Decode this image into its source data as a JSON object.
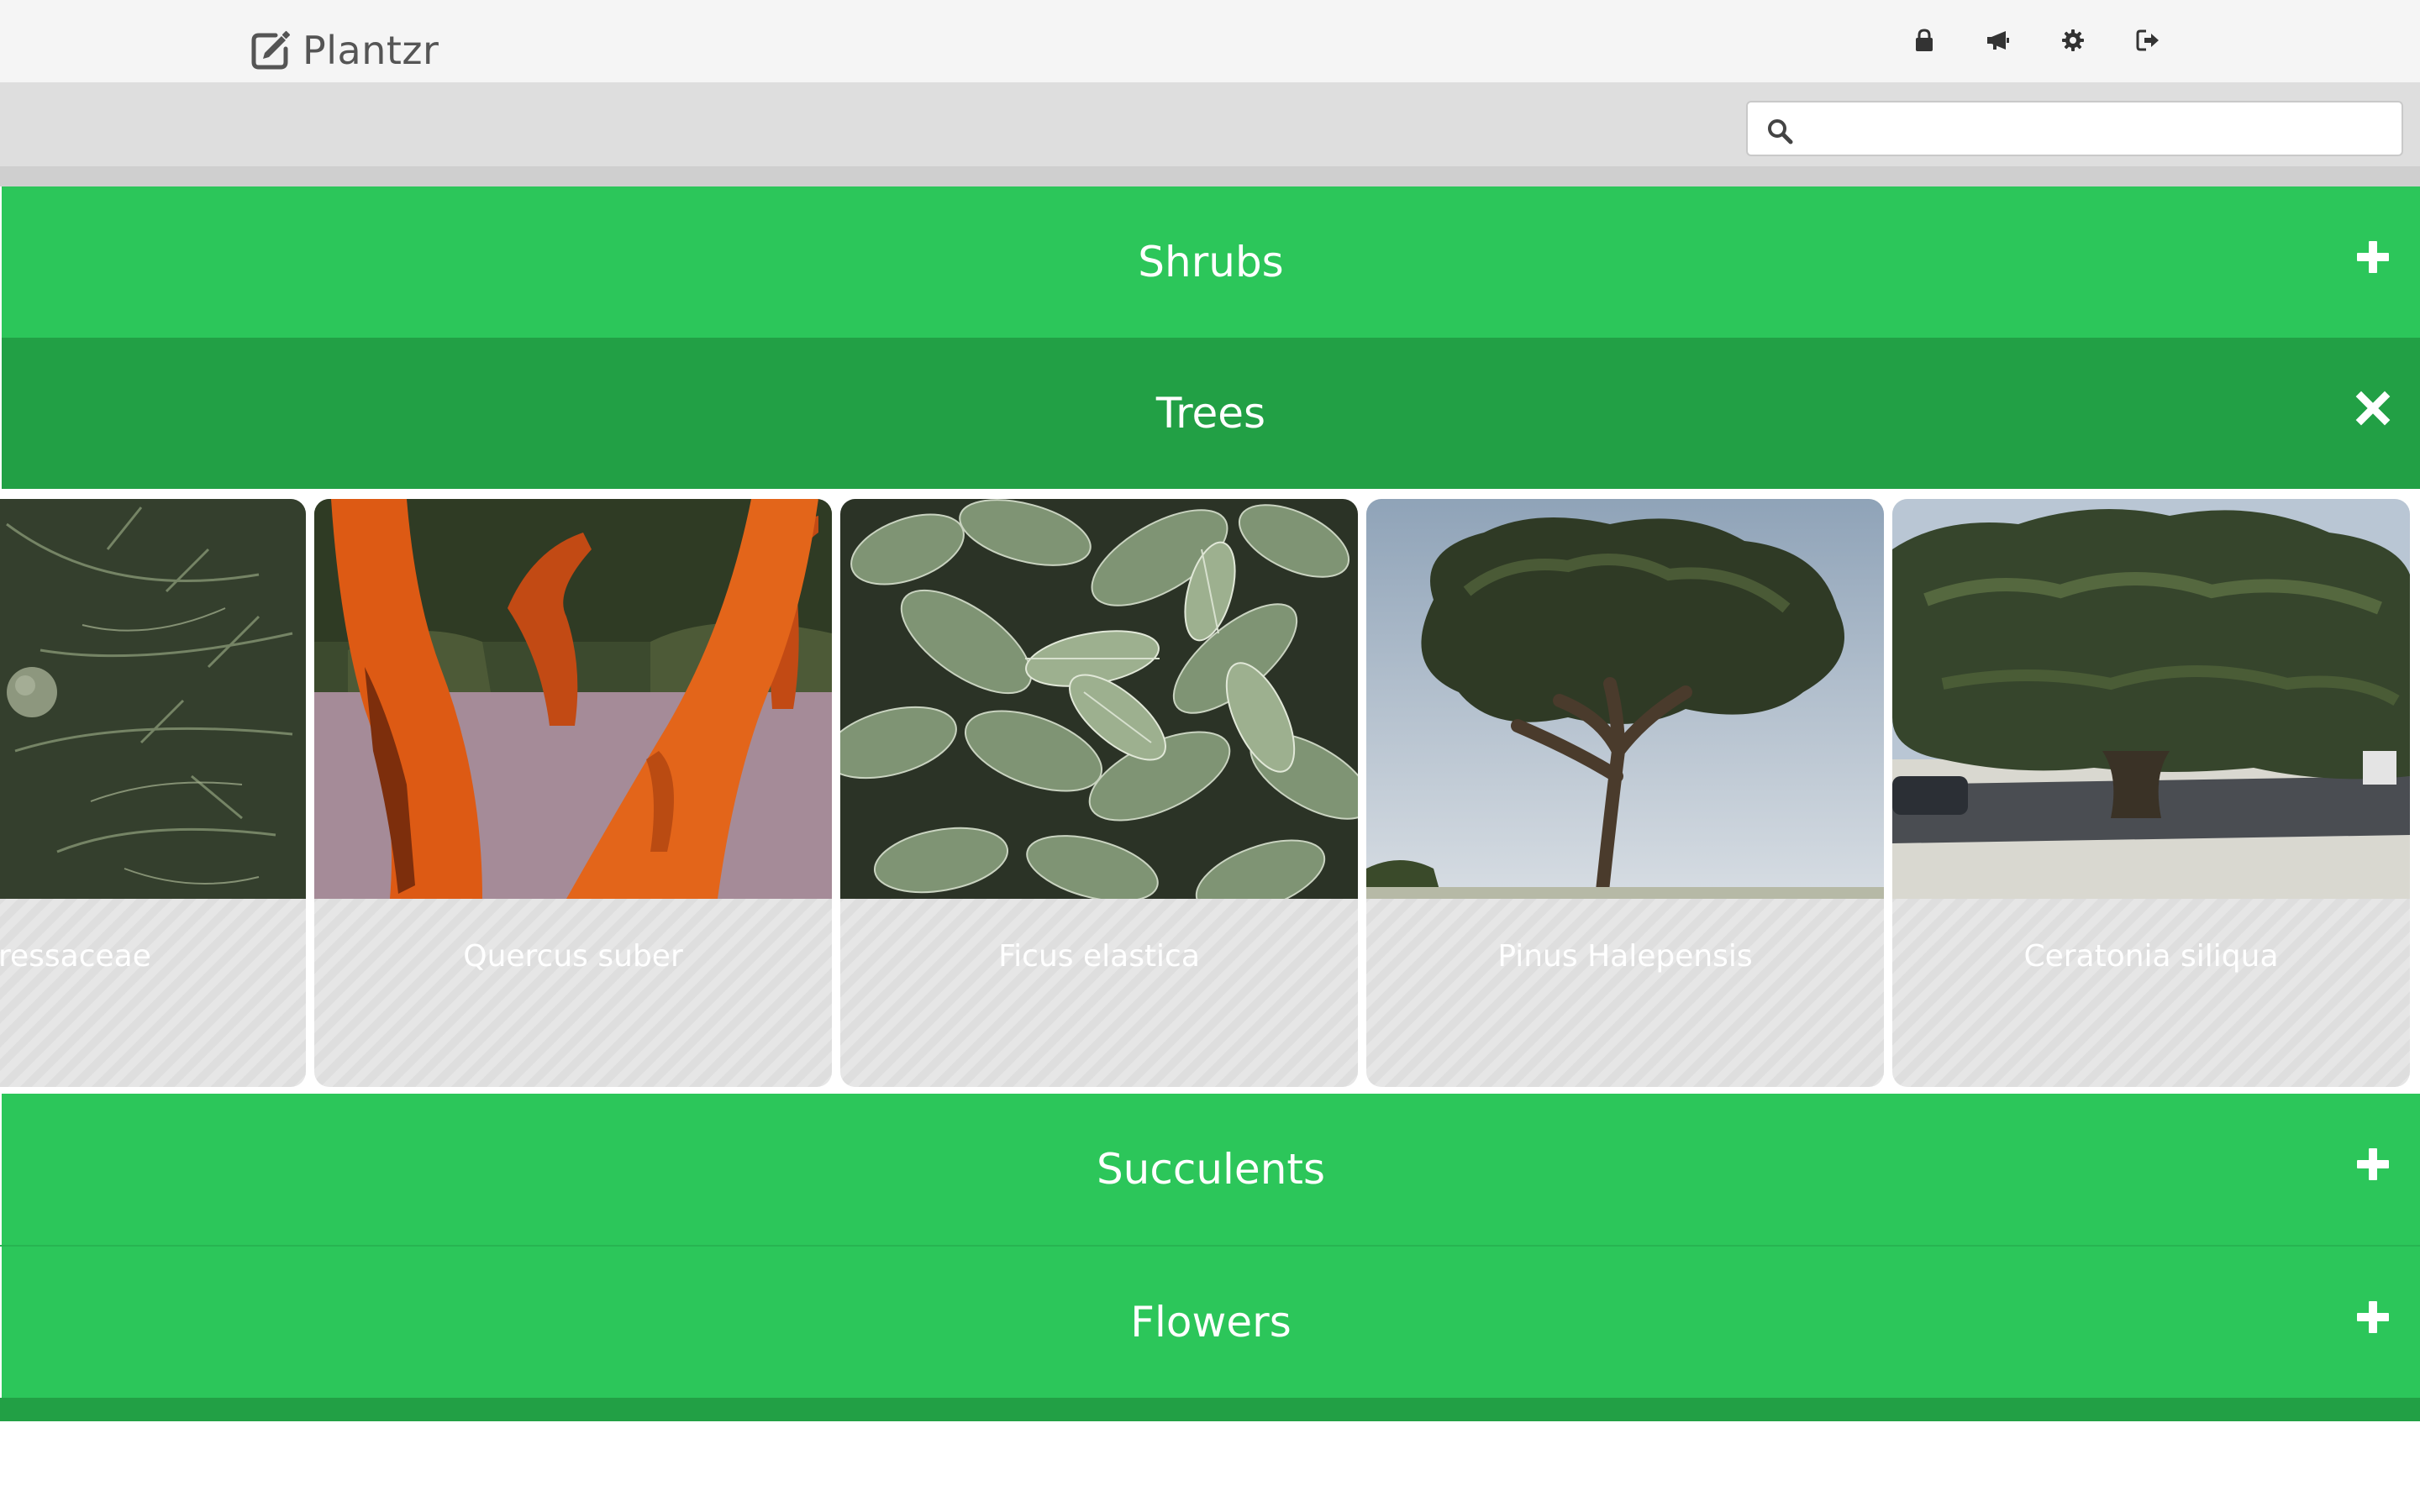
{
  "app": {
    "brand": "Plantzr",
    "nav_icons": [
      "lock-icon",
      "bullhorn-icon",
      "gear-icon",
      "sign-out-icon"
    ]
  },
  "search": {
    "placeholder": "",
    "value": ""
  },
  "categories": [
    {
      "name": "Shrubs",
      "state": "collapsed",
      "toggle_icon": "plus-icon"
    },
    {
      "name": "Trees",
      "state": "expanded",
      "toggle_icon": "close-icon",
      "plants": [
        {
          "name": "ressaceae",
          "image": "cypress-foliage-photo"
        },
        {
          "name": "Quercus suber",
          "image": "cork-oak-trunks-photo"
        },
        {
          "name": "Ficus elastica",
          "image": "rubber-plant-leaves-photo"
        },
        {
          "name": "Pinus Halepensis",
          "image": "aleppo-pine-tree-photo"
        },
        {
          "name": "Ceratonia siliqua",
          "image": "carob-tree-photo"
        }
      ]
    },
    {
      "name": "Succulents",
      "state": "collapsed",
      "toggle_icon": "plus-icon"
    },
    {
      "name": "Flowers",
      "state": "collapsed",
      "toggle_icon": "plus-icon"
    }
  ],
  "colors": {
    "category_green": "#2cc65a",
    "category_green_active": "#22a045",
    "navbar_bg": "#f5f5f5",
    "searchbar_bg": "#dedede"
  }
}
